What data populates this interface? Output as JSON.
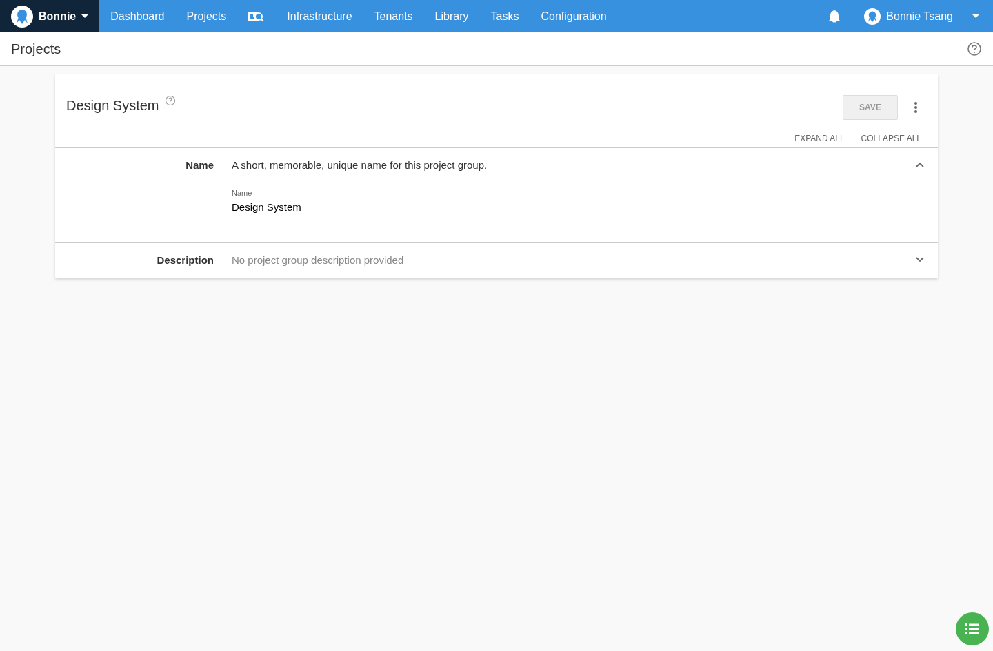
{
  "navbar": {
    "space": "Bonnie",
    "items": [
      {
        "kind": "text",
        "label": "Dashboard"
      },
      {
        "kind": "text",
        "label": "Projects"
      },
      {
        "kind": "icon"
      },
      {
        "kind": "text",
        "label": "Infrastructure"
      },
      {
        "kind": "text",
        "label": "Tenants"
      },
      {
        "kind": "text",
        "label": "Library"
      },
      {
        "kind": "text",
        "label": "Tasks"
      },
      {
        "kind": "text",
        "label": "Configuration"
      }
    ],
    "user": "Bonnie Tsang"
  },
  "page_title": "Projects",
  "card": {
    "title": "Design System",
    "save": {
      "label": "SAVE",
      "disabled": true
    },
    "expand_all": "EXPAND ALL",
    "collapse_all": "COLLAPSE ALL",
    "sections": [
      {
        "label": "Name",
        "summary": "A short, memorable, unique name for this project group.",
        "muted": false,
        "expanded": true,
        "field": {
          "label": "Name",
          "value": "Design System"
        }
      },
      {
        "label": "Description",
        "summary": "No project group description provided",
        "muted": true,
        "expanded": false
      }
    ]
  }
}
